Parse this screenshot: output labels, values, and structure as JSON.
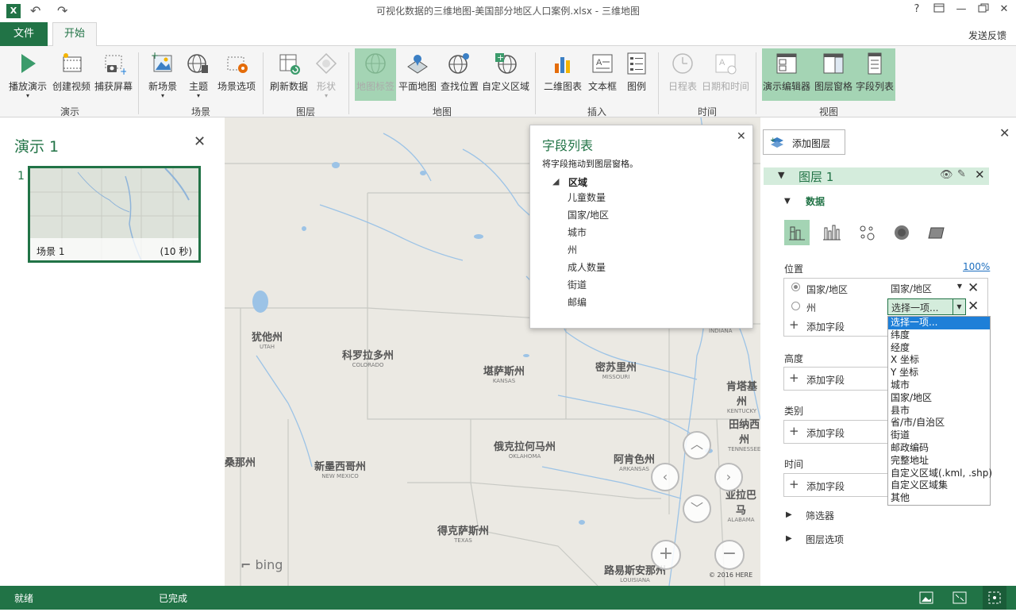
{
  "window": {
    "title": "可视化数据的三维地图-美国部分地区人口案例.xlsx - 三维地图",
    "help": "?",
    "minimize": "—",
    "close": "✕"
  },
  "tabs": {
    "file": "文件",
    "home": "开始"
  },
  "feedback": "发送反馈",
  "ribbon": {
    "groups": [
      "演示",
      "场景",
      "图层",
      "地图",
      "插入",
      "时间",
      "视图"
    ],
    "buttons": {
      "play_tour": "播放演示",
      "create_video": "创建视频",
      "capture_screen": "捕获屏幕",
      "new_scene": "新场景",
      "themes": "主题",
      "scene_options": "场景选项",
      "refresh_data": "刷新数据",
      "shapes": "形状",
      "map_labels": "地图标签",
      "flat_map": "平面地图",
      "find_location": "查找位置",
      "custom_regions": "自定义区域",
      "2d_chart": "二维图表",
      "text_box": "文本框",
      "legend": "图例",
      "timeline": "日程表",
      "date_time": "日期和时间",
      "tour_editor": "演示编辑器",
      "layer_pane": "图层窗格",
      "field_list": "字段列表"
    }
  },
  "tour": {
    "title": "演示 1",
    "scene_number": "1",
    "scene_name": "场景 1",
    "scene_duration": "(10 秒)"
  },
  "map": {
    "states": [
      {
        "zh": "犹他州",
        "en": "UTAH"
      },
      {
        "zh": "科罗拉多州",
        "en": "COLORADO"
      },
      {
        "zh": "堪萨斯州",
        "en": "KANSAS"
      },
      {
        "zh": "密苏里州",
        "en": "MISSOURI"
      },
      {
        "zh": "肯塔基州",
        "en": "KENTUCKY"
      },
      {
        "zh": "田纳西州",
        "en": "TENNESSEE"
      },
      {
        "zh": "俄克拉何马州",
        "en": "OKLAHOMA"
      },
      {
        "zh": "阿肯色州",
        "en": "ARKANSAS"
      },
      {
        "zh": "新墨西哥州",
        "en": "NEW MEXICO"
      },
      {
        "zh": "得克萨斯州",
        "en": "TEXAS"
      },
      {
        "zh": "路易斯安那州",
        "en": "LOUISIANA"
      },
      {
        "zh": "亚拉巴马",
        "en": "ALABAMA"
      },
      {
        "zh": "桑那州",
        "en": ""
      },
      {
        "zh": "",
        "en": "INDIANA"
      }
    ],
    "bing": "bing",
    "copyright": "© 2016 HERE"
  },
  "field_list": {
    "title": "字段列表",
    "instruction": "将字段拖动到图层窗格。",
    "table": "区域",
    "fields": [
      "儿童数量",
      "国家/地区",
      "城市",
      "州",
      "成人数量",
      "街道",
      "邮编"
    ]
  },
  "layer_pane": {
    "add_layer": "添加图层",
    "layer_name": "图层 1",
    "data_label": "数据",
    "location_label": "位置",
    "percent": "100%",
    "location_rows": [
      {
        "field": "国家/地区",
        "type": "国家/地区"
      },
      {
        "field": "州",
        "type": "选择一项..."
      }
    ],
    "add_field": "添加字段",
    "height_label": "高度",
    "category_label": "类别",
    "time_label": "时间",
    "filters": "筛选器",
    "layer_options": "图层选项",
    "dropdown_options": [
      "选择一项...",
      "纬度",
      "经度",
      "X 坐标",
      "Y 坐标",
      "城市",
      "国家/地区",
      "县市",
      "省/市/自治区",
      "街道",
      "邮政编码",
      "完整地址",
      "自定义区域(.kml, .shp)",
      "自定义区域集",
      "其他"
    ]
  },
  "status": {
    "ready": "就绪",
    "done": "已完成"
  },
  "colors": {
    "accent": "#217346",
    "highlight": "#1e7fd8",
    "selected": "#a4d4b4"
  }
}
